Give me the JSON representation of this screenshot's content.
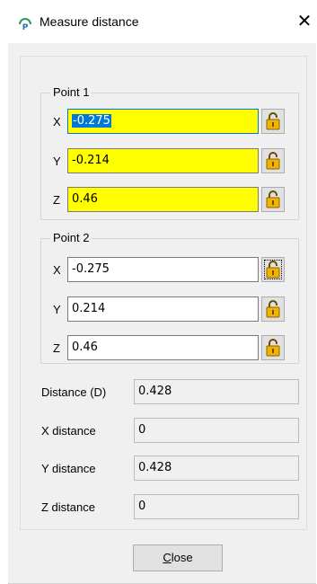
{
  "window": {
    "title": "Measure distance",
    "close_glyph": "✕",
    "icon": "measure-app-icon"
  },
  "point1": {
    "title": "Point 1",
    "x_label": "X",
    "x_value": "-0.275",
    "y_label": "Y",
    "y_value": "-0.214",
    "z_label": "Z",
    "z_value": "0.46",
    "highlight_color": "#ffff00"
  },
  "point2": {
    "title": "Point 2",
    "x_label": "X",
    "x_value": "-0.275",
    "y_label": "Y",
    "y_value": "0.214",
    "z_label": "Z",
    "z_value": "0.46"
  },
  "results": {
    "distance_label": "Distance (D)",
    "distance_value": "0.428",
    "x_label": "X distance",
    "x_value": "0",
    "y_label": "Y distance",
    "y_value": "0.428",
    "z_label": "Z distance",
    "z_value": "0"
  },
  "footer": {
    "close_mnemonic": "C",
    "close_rest": "lose"
  },
  "colors": {
    "focus_accent": "#0078d7",
    "lock_body": "#f0b400"
  },
  "icons": {
    "lock": "padlock-open-icon"
  }
}
